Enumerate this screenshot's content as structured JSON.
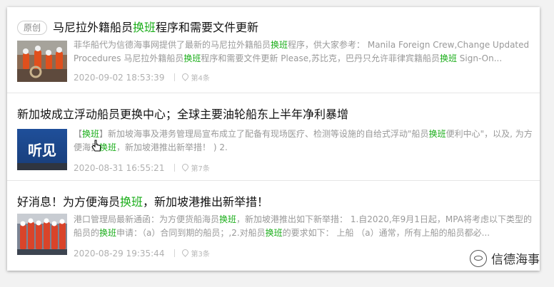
{
  "colors": {
    "highlight": "#1aad19",
    "text": "#111111",
    "muted": "#999999"
  },
  "articles": [
    {
      "badge": "原创",
      "title_parts": [
        "马尼拉外籍船员",
        "换班",
        "程序和需要文件更新"
      ],
      "snippet_parts": [
        "菲华船代为信德海事网提供了最新的马尼拉外籍船员",
        "换班",
        "程序，供大家参考： Manila Foreign Crew,Change Updated Procedures 马尼拉外籍船员",
        "换班",
        "程序和需要文件更新 Please,苏比克，巴丹只允许菲律宾籍船员",
        "换班",
        " Sign-On..."
      ],
      "date": "2020-09-02 18:53:39",
      "position": "第4条"
    },
    {
      "title_parts": [
        "新加坡成立浮动船员更换中心；全球主要油轮船东上半年净利暴增"
      ],
      "snippet_parts": [
        "【",
        "换班",
        "】新加坡海事及港务管理局宣布成立了配备有现场医疗、检测等设施的自给式浮动\"船员",
        "换班",
        "便利中心\"，以及, 为方便海员",
        "换班",
        "，新加坡港推出新举措！ ) 2."
      ],
      "thumb_text": "听见",
      "date": "2020-08-31 16:55:21",
      "position": "第7条"
    },
    {
      "title_parts": [
        "好消息！为方便海员",
        "换班",
        "，新加坡港推出新举措！"
      ],
      "snippet_parts": [
        "港口管理局最新通函：为方便货船海员",
        "换班",
        "，新加坡港推出如下新举措： 1.自2020,年9月1日起，MPA将考虑以下类型的船员的",
        "换班",
        "申请：（a）合同到期的船员；,2.对船员",
        "换班",
        "的要求如下： 上船 （a）通常，所有上船的船员都必..."
      ],
      "date": "2020-08-29 19:35:44",
      "position": "第3条"
    }
  ],
  "watermark": "信德海事"
}
